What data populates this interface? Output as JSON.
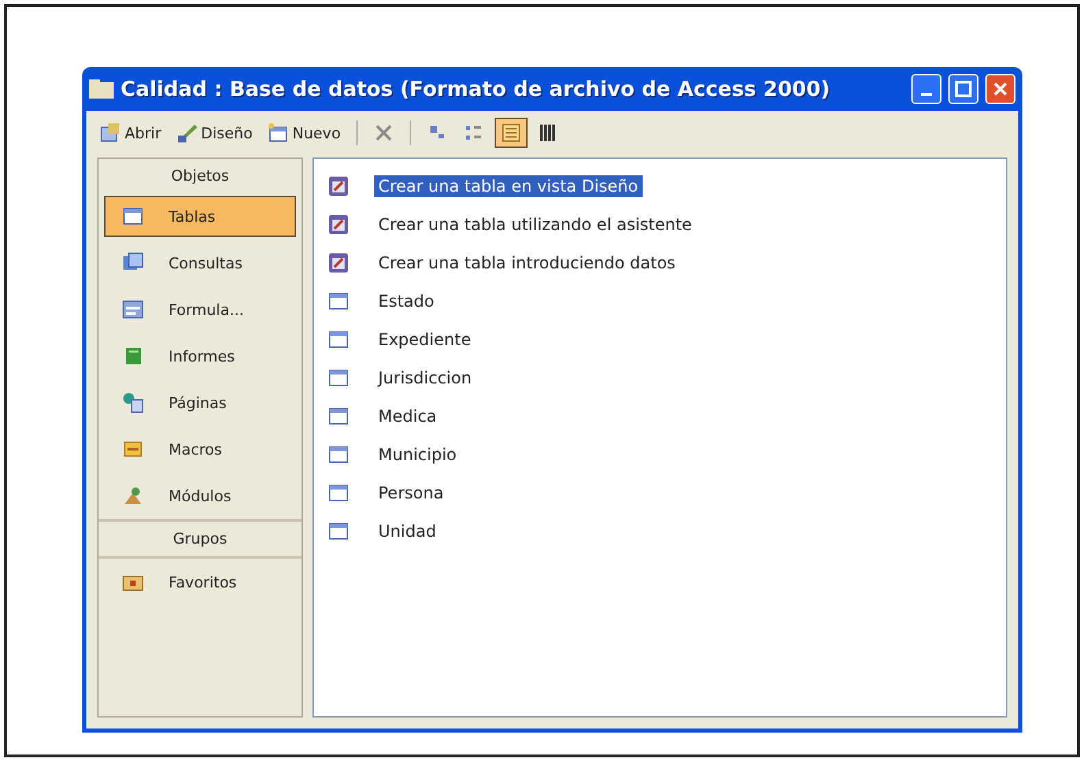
{
  "window": {
    "title": "Calidad : Base de datos (Formato de archivo de Access 2000)"
  },
  "toolbar": [
    {
      "kind": "button",
      "label": "Abrir"
    },
    {
      "kind": "button",
      "label": "Diseño"
    },
    {
      "kind": "button",
      "label": "Nuevo"
    },
    {
      "kind": "separator"
    },
    {
      "kind": "icon",
      "selected": false
    },
    {
      "kind": "separator"
    },
    {
      "kind": "icon",
      "selected": false
    },
    {
      "kind": "icon",
      "selected": false
    },
    {
      "kind": "icon",
      "selected": true
    },
    {
      "kind": "icon",
      "selected": false
    }
  ],
  "sidebar": {
    "objects_header": "Objetos",
    "items": [
      {
        "label": "Tablas",
        "selected": true
      },
      {
        "label": "Consultas",
        "selected": false
      },
      {
        "label": "Formula...",
        "selected": false
      },
      {
        "label": "Informes",
        "selected": false
      },
      {
        "label": "Páginas",
        "selected": false
      },
      {
        "label": "Macros",
        "selected": false
      },
      {
        "label": "Módulos",
        "selected": false
      }
    ],
    "groups_header": "Grupos",
    "groups": [
      {
        "label": "Favoritos",
        "selected": false
      }
    ]
  },
  "list": [
    {
      "label": "Crear una tabla en vista Diseño",
      "kind": "shortcut",
      "selected": true
    },
    {
      "label": "Crear una tabla utilizando el asistente",
      "kind": "shortcut",
      "selected": false
    },
    {
      "label": "Crear una tabla introduciendo datos",
      "kind": "shortcut",
      "selected": false
    },
    {
      "label": "Estado",
      "kind": "table",
      "selected": false
    },
    {
      "label": "Expediente",
      "kind": "table",
      "selected": false
    },
    {
      "label": "Jurisdiccion",
      "kind": "table",
      "selected": false
    },
    {
      "label": "Medica",
      "kind": "table",
      "selected": false
    },
    {
      "label": "Municipio",
      "kind": "table",
      "selected": false
    },
    {
      "label": "Persona",
      "kind": "table",
      "selected": false
    },
    {
      "label": "Unidad",
      "kind": "table",
      "selected": false
    }
  ]
}
